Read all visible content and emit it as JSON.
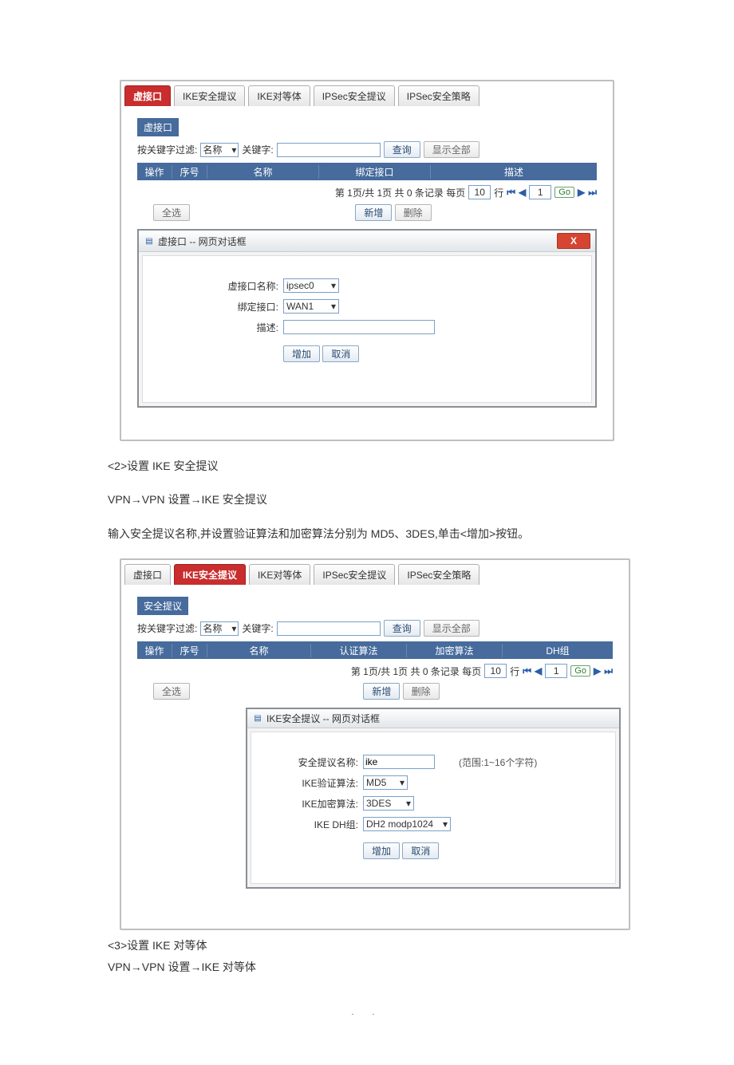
{
  "tabs": {
    "t0": "虚接口",
    "t1": "IKE安全提议",
    "t2": "IKE对等体",
    "t3": "IPSec安全提议",
    "t4": "IPSec安全策略"
  },
  "common": {
    "filter_prefix": "按关键字过滤:",
    "filter_sel": "名称",
    "kw_label": "关键字:",
    "query_btn": "查询",
    "showall_btn": "显示全部",
    "pager_text": "第 1页/共 1页 共 0 条记录 每页",
    "pager_rows": "10",
    "pager_unit": "行",
    "pager_page": "1",
    "go": "Go",
    "add_btn": "新增",
    "del_btn": "删除",
    "selectall_btn": "全选",
    "dlg_add": "增加",
    "dlg_cancel": "取消",
    "close_x": "X"
  },
  "panel1": {
    "section": "虚接口",
    "cols": {
      "op": "操作",
      "idx": "序号",
      "name": "名称",
      "bind": "绑定接口",
      "desc": "描述"
    },
    "dlg_title": "虚接口 -- 网页对话框",
    "lbl_name": "虚接口名称:",
    "lbl_bind": "绑定接口:",
    "lbl_desc": "描述:",
    "v_name": "ipsec0",
    "v_bind": "WAN1"
  },
  "panel2": {
    "section": "安全提议",
    "cols": {
      "op": "操作",
      "idx": "序号",
      "name": "名称",
      "auth": "认证算法",
      "enc": "加密算法",
      "dh": "DH组"
    },
    "dlg_title": "IKE安全提议 -- 网页对话框",
    "lbl_name": "安全提议名称:",
    "lbl_auth": "IKE验证算法:",
    "lbl_enc": "IKE加密算法:",
    "lbl_dh": "IKE DH组:",
    "v_name": "ike",
    "v_auth": "MD5",
    "v_enc": "3DES",
    "v_dh": "DH2 modp1024",
    "hint": "(范围:1~16个字符)"
  },
  "text": {
    "s2_title": "<2>设置 IKE 安全提议",
    "s2_path": "VPN→VPN 设置→IKE 安全提议",
    "s2_desc": "输入安全提议名称,并设置验证算法和加密算法分别为 MD5、3DES,单击<增加>按钮。",
    "s3_title": "<3>设置 IKE 对等体",
    "s3_path": "VPN→VPN 设置→IKE 对等体"
  },
  "footer": ". ."
}
